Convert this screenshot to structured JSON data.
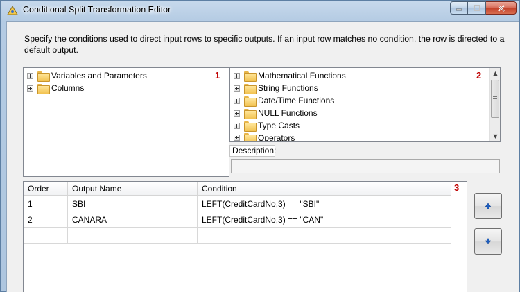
{
  "window": {
    "title": "Conditional Split Transformation Editor"
  },
  "description": "Specify the conditions used to direct input rows to specific outputs. If an input row matches no condition, the row is directed to a default output.",
  "left_tree": {
    "number_label": "1",
    "items": [
      {
        "label": "Variables and Parameters"
      },
      {
        "label": "Columns"
      }
    ]
  },
  "right_tree": {
    "number_label": "2",
    "items": [
      {
        "label": "Mathematical Functions"
      },
      {
        "label": "String Functions"
      },
      {
        "label": "Date/Time Functions"
      },
      {
        "label": "NULL Functions"
      },
      {
        "label": "Type Casts"
      },
      {
        "label": "Operators"
      }
    ]
  },
  "description_panel": {
    "label": "Description:",
    "value": ""
  },
  "grid": {
    "number_label": "3",
    "columns": [
      "Order",
      "Output Name",
      "Condition"
    ],
    "rows": [
      {
        "order": "1",
        "output_name": "SBI",
        "condition": "LEFT(CreditCardNo,3) == \"SBI\""
      },
      {
        "order": "2",
        "output_name": "CANARA",
        "condition": "LEFT(CreditCardNo,3) == \"CAN\""
      }
    ]
  },
  "buttons": {
    "move_up_icon": "arrow-up-icon",
    "move_down_icon": "arrow-down-icon"
  },
  "colors": {
    "accent_number": "#c00000",
    "arrow_blue": "#1f5fbf"
  }
}
